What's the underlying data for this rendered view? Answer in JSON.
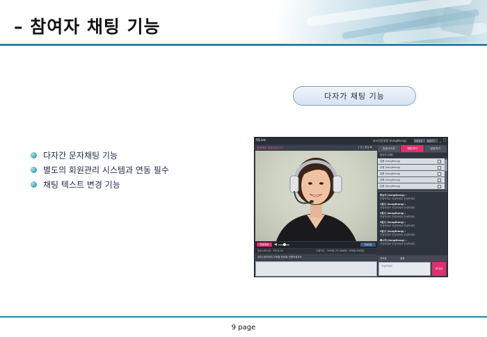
{
  "header": {
    "title": "– 참여자 채팅 기능"
  },
  "feature_badge": "다자가 채팅 기능",
  "bullets": [
    "다자간 문자채팅 기능",
    "별도의 회원관리 시스템과 연동 필수",
    "채팅 텍스트 변경 기능"
  ],
  "app": {
    "logo": "NLive",
    "user": "회고인동설명 (hongthong)",
    "title_buttons": [
      "환경설정",
      "종료하기"
    ],
    "window_controls": [
      "_",
      "□",
      "×"
    ],
    "video_caption": "현라에라 방송송입니다.",
    "video_controls": "[ 빔 ] 중질 ▼",
    "broadcast_button": "방송종료",
    "fullscreen_button": "전체화면",
    "status_left": "방송시작시간 : PM 6:30",
    "status_right": "시청자수 : 999명 (PC 888명 / 모바일 888명)",
    "notice": "공지] 현라에라 교육을 방송을 진행하세요요",
    "tabs": [
      "방송리스트",
      "채팅하기",
      "방송하기"
    ],
    "viewers_header": "접속자 (5명)",
    "viewers": [
      "강봉 (hongthong)",
      "강봉 (hongthong)",
      "강봉 (hongthong)",
      "강봉 (hongthong)",
      "강봉 (hongthong)"
    ],
    "chat_log": [
      {
        "name": "방송자 (hongthong) :",
        "msg": "안녕하세요 안녕하세요 안녕하세요"
      },
      {
        "name": "1참고 (hongthong) :",
        "msg": "안녕하세요 안녕하세요 안녕하세요"
      },
      {
        "name": "2참고 (hongthong) :",
        "msg": "안녕하세요 안녕하세요 안녕하세요"
      },
      {
        "name": "3참고 (hongthong) :",
        "msg": "안녕하세요 안녕하세요 안녕하세요"
      },
      {
        "name": "4참고 (hongthong) :",
        "msg": "안녕하세요 안녕하세요 안녕하세요"
      },
      {
        "name": "빠니저 (hongthong) :",
        "msg": "안녕하세요 안녕하세요 안녕하세요"
      }
    ],
    "chat_options": [
      "귓속말",
      "설정"
    ],
    "chat_input": "안녕하세요",
    "send_button": "보내기"
  },
  "footer": {
    "page": "9 page"
  },
  "colors": {
    "accent_blue": "#2f7fa3",
    "app_pink": "#e22e6f",
    "app_dark": "#333a44"
  }
}
